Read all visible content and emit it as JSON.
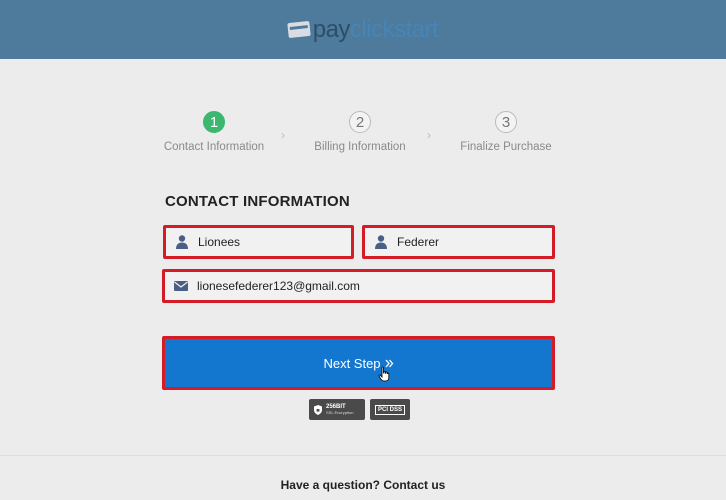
{
  "header": {
    "logo_part1": "pay",
    "logo_part2": "clickstart"
  },
  "steps": [
    {
      "number": "1",
      "label": "Contact Information",
      "active": true
    },
    {
      "number": "2",
      "label": "Billing Information",
      "active": false
    },
    {
      "number": "3",
      "label": "Finalize Purchase",
      "active": false
    }
  ],
  "form": {
    "section_title": "CONTACT INFORMATION",
    "first_name": "Lionees",
    "last_name": "Federer",
    "email": "lionesefederer123@gmail.com"
  },
  "next_button": {
    "label": "Next Step",
    "icon": "double-chevron-right-icon"
  },
  "badges": {
    "ssl_line1": "256BIT",
    "ssl_line2": "SSL Encryption",
    "pci_label": "PCI DSS"
  },
  "footer": {
    "text": "Have a question? Contact us"
  },
  "colors": {
    "header_bg": "#4e7a9c",
    "button_bg": "#1377d0",
    "active_step": "#3bb76f",
    "highlight_border": "#d51c26"
  }
}
